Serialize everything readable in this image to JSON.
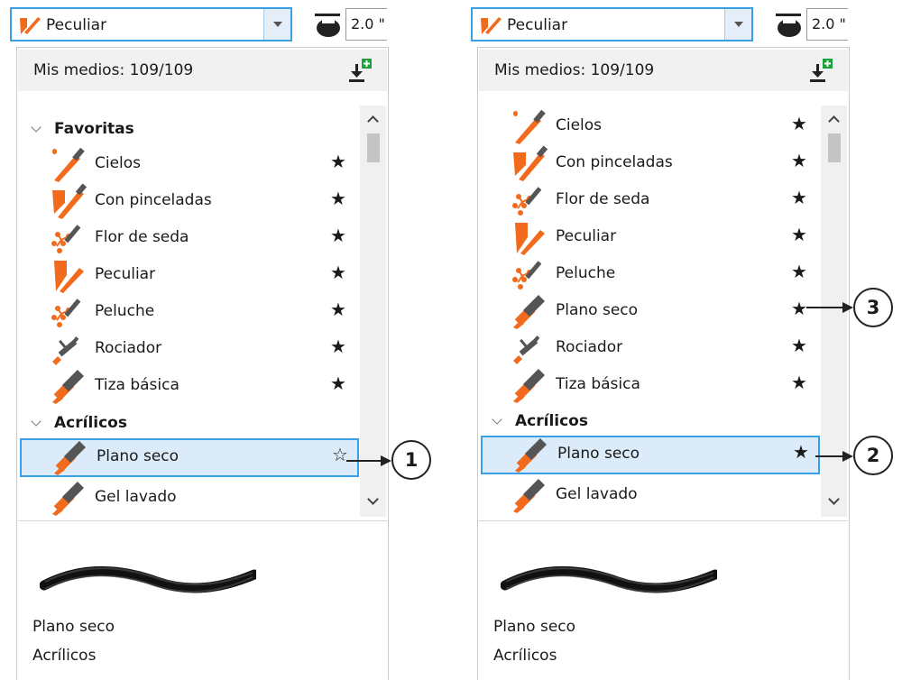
{
  "colors": {
    "accent": "#3aa0e6",
    "brush_orange": "#f26b1d",
    "selection_bg": "#dcebfa"
  },
  "icons": {
    "select_icon": "peculiar-brush-icon",
    "size_icon": "nib-size-icon",
    "import_icon": "import-media-icon",
    "star_filled": "star-filled-icon",
    "star_empty": "star-outline-icon"
  },
  "panels": [
    {
      "brush_selector": {
        "value": "Peculiar"
      },
      "size": {
        "value": "2.0 \""
      },
      "media": {
        "label": "Mis medios: 109/109"
      },
      "groups": [
        {
          "label": "Favoritas",
          "items": [
            {
              "label": "Cielos",
              "icon": "cielos",
              "star": "★"
            },
            {
              "label": "Con pinceladas",
              "icon": "pinceladas",
              "star": "★"
            },
            {
              "label": "Flor de seda",
              "icon": "flor",
              "star": "★"
            },
            {
              "label": "Peculiar",
              "icon": "peculiar",
              "star": "★"
            },
            {
              "label": "Peluche",
              "icon": "flor",
              "star": "★"
            },
            {
              "label": "Rociador",
              "icon": "rociador",
              "star": "★"
            },
            {
              "label": "Tiza básica",
              "icon": "tiza",
              "star": "★"
            }
          ]
        },
        {
          "label": "Acrílicos",
          "items": [
            {
              "label": "Plano seco",
              "icon": "tiza",
              "star": "☆",
              "selected": true
            },
            {
              "label": "Gel lavado",
              "icon": "tiza",
              "star": ""
            }
          ]
        }
      ],
      "preview": {
        "name": "Plano seco",
        "category": "Acrílicos"
      },
      "callouts": [
        {
          "number": "1"
        }
      ]
    },
    {
      "brush_selector": {
        "value": "Peculiar"
      },
      "size": {
        "value": "2.0 \""
      },
      "media": {
        "label": "Mis medios: 109/109"
      },
      "groups": [
        {
          "label": "",
          "items": [
            {
              "label": "Cielos",
              "icon": "cielos",
              "star": "★"
            },
            {
              "label": "Con pinceladas",
              "icon": "pinceladas",
              "star": "★"
            },
            {
              "label": "Flor de seda",
              "icon": "flor",
              "star": "★"
            },
            {
              "label": "Peculiar",
              "icon": "peculiar",
              "star": "★"
            },
            {
              "label": "Peluche",
              "icon": "flor",
              "star": "★"
            },
            {
              "label": "Plano seco",
              "icon": "tiza",
              "star": "★"
            },
            {
              "label": "Rociador",
              "icon": "rociador",
              "star": "★"
            },
            {
              "label": "Tiza básica",
              "icon": "tiza",
              "star": "★"
            }
          ]
        },
        {
          "label": "Acrílicos",
          "items": [
            {
              "label": "Plano seco",
              "icon": "tiza",
              "star": "★",
              "selected": true
            },
            {
              "label": "Gel lavado",
              "icon": "tiza",
              "star": ""
            }
          ]
        }
      ],
      "preview": {
        "name": "Plano seco",
        "category": "Acrílicos"
      },
      "callouts": [
        {
          "number": "3"
        },
        {
          "number": "2"
        }
      ]
    }
  ]
}
